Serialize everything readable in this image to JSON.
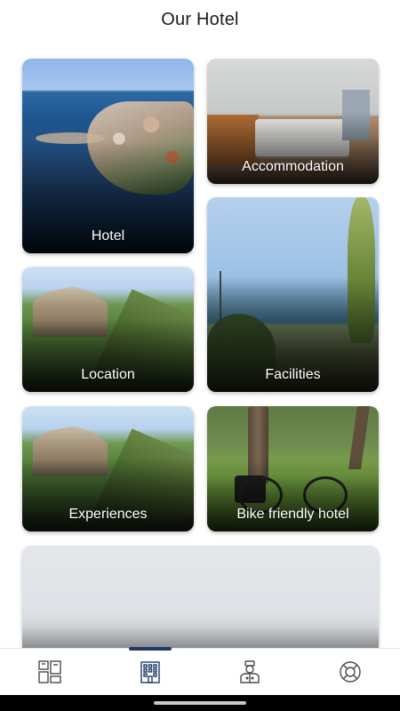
{
  "header": {
    "title": "Our Hotel"
  },
  "cards": [
    {
      "label": "Hotel"
    },
    {
      "label": "Accommodation"
    },
    {
      "label": "Location"
    },
    {
      "label": "Facilities"
    },
    {
      "label": "Experiences"
    },
    {
      "label": "Bike friendly hotel"
    }
  ],
  "bottom_nav": {
    "items": [
      {
        "icon": "dashboard-icon",
        "active": false
      },
      {
        "icon": "building-icon",
        "active": true
      },
      {
        "icon": "concierge-icon",
        "active": false
      },
      {
        "icon": "lifebuoy-icon",
        "active": false
      }
    ],
    "active_color": "#1f3a66"
  }
}
